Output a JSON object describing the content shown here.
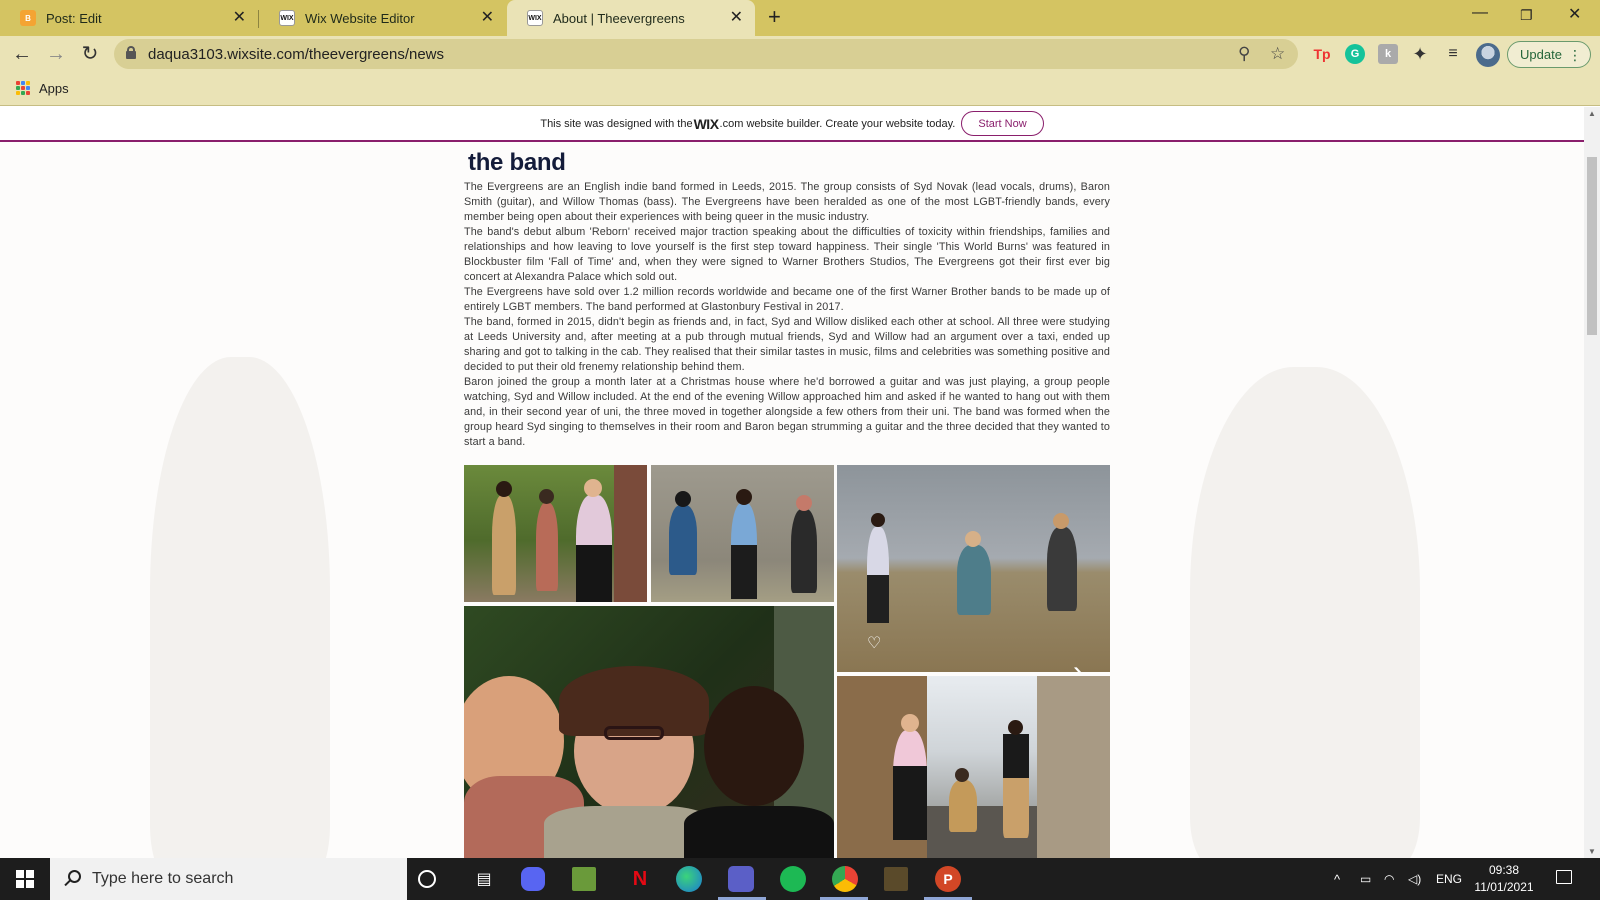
{
  "browser": {
    "tabs": [
      {
        "title": "Post: Edit",
        "favicon": "blogger-icon",
        "active": false
      },
      {
        "title": "Wix Website Editor",
        "favicon": "wix-icon",
        "active": false
      },
      {
        "title": "About | Theevergreens",
        "favicon": "wix-icon",
        "active": true
      }
    ],
    "url": "daqua3103.wixsite.com/theevergreens/news",
    "update_label": "Update",
    "bookmarks": [
      {
        "label": "Apps"
      }
    ],
    "wix_favicon_text": "WIX",
    "blogger_favicon_text": "B"
  },
  "wix_banner": {
    "text_before": "This site was designed with the ",
    "logo": "WIX",
    "text_after": ".com website builder. Create your website today.",
    "button": "Start Now"
  },
  "page": {
    "title": "the band",
    "paragraphs": [
      "The Evergreens are an English indie band formed in Leeds, 2015. The group consists of Syd Novak (lead vocals, drums), Baron Smith (guitar), and Willow Thomas (bass). The Evergreens have been heralded as one of the most LGBT-friendly bands, every member being open about their experiences with being queer in the music industry.",
      "The band's debut album 'Reborn' received major traction speaking about the difficulties of toxicity within friendships, families and relationships and how leaving to love yourself is the first step toward happiness. Their single 'This World Burns' was featured in Blockbuster film 'Fall of Time' and, when they were signed to Warner Brothers Studios, The Evergreens got their first ever big concert at Alexandra Palace which sold out.",
      "The Evergreens have sold over 1.2 million records worldwide and became one of the first Warner Brother bands to be made up of entirely LGBT members. The band performed at Glastonbury Festival in 2017.",
      "The band, formed in 2015, didn't begin as friends and, in fact, Syd and Willow disliked each other at school. All three were studying at Leeds University and, after meeting at a pub through mutual friends, Syd and Willow had an argument over a taxi, ended up sharing and got to talking in the cab. They realised that their similar tastes in music, films and celebrities was something positive and decided to put their old frenemy relationship behind them.",
      "Baron joined the group a month later at a Christmas house where he'd borrowed a guitar and was just playing, a group people watching, Syd and Willow included. At the end of the evening Willow approached him and asked if he wanted to hang out with them and, in their second year of uni, the three moved in together alongside a few others from their uni. The band was formed when the group heard Syd singing to themselves in their room and Baron began strumming a guitar and the three decided that they wanted to start a band."
    ],
    "gallery_photos": [
      {
        "name": "band-in-alley-photo"
      },
      {
        "name": "band-at-stone-wall-photo"
      },
      {
        "name": "band-in-field-photo"
      },
      {
        "name": "band-closeup-photo"
      },
      {
        "name": "band-in-lane-photo"
      }
    ]
  },
  "taskbar": {
    "search_placeholder": "Type here to search",
    "pinned": [
      "cortana-icon",
      "task-view-icon",
      "discord-icon",
      "minecraft-icon",
      "netflix-icon",
      "edge-icon",
      "teams-icon",
      "spotify-icon",
      "chrome-icon",
      "app-icon",
      "powerpoint-icon"
    ],
    "netflix_label": "N",
    "powerpoint_label": "P",
    "language": "ENG",
    "time": "09:38",
    "date": "11/01/2021"
  },
  "colors": {
    "tab_strip": "#d4c462",
    "toolbar": "#eae3b6",
    "wix_accent": "#8a1f6c",
    "title": "#141c3a",
    "taskbar": "#1d1d1d"
  }
}
